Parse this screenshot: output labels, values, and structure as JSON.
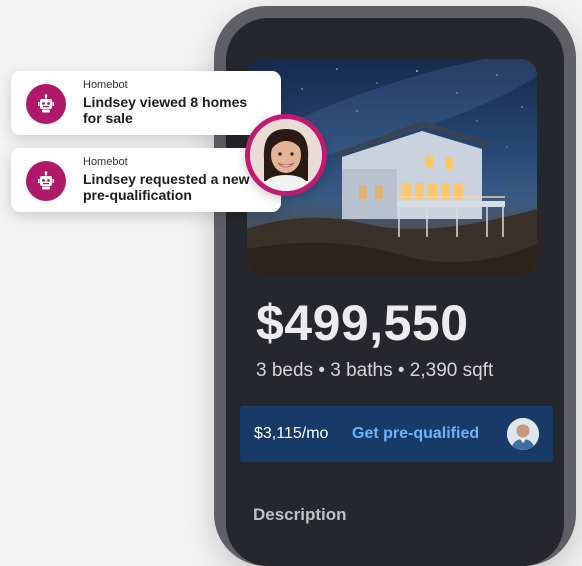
{
  "listing": {
    "price": "$499,550",
    "details": "3 beds • 3 baths • 2,390 sqft",
    "monthly_payment": "$3,115/mo",
    "prequal_label": "Get pre-qualified",
    "description_heading": "Description"
  },
  "notifications": [
    {
      "sender": "Homebot",
      "message": "Lindsey viewed 8 homes for sale",
      "icon": "robot-icon"
    },
    {
      "sender": "Homebot",
      "message": "Lindsey requested a new pre-qualification",
      "icon": "robot-icon"
    }
  ],
  "colors": {
    "brand": "#b0186a",
    "phone_frame": "#5f6066",
    "screen_bg": "#26272c",
    "prequal_bar": "#173a66",
    "prequal_link": "#6cb4ff"
  }
}
